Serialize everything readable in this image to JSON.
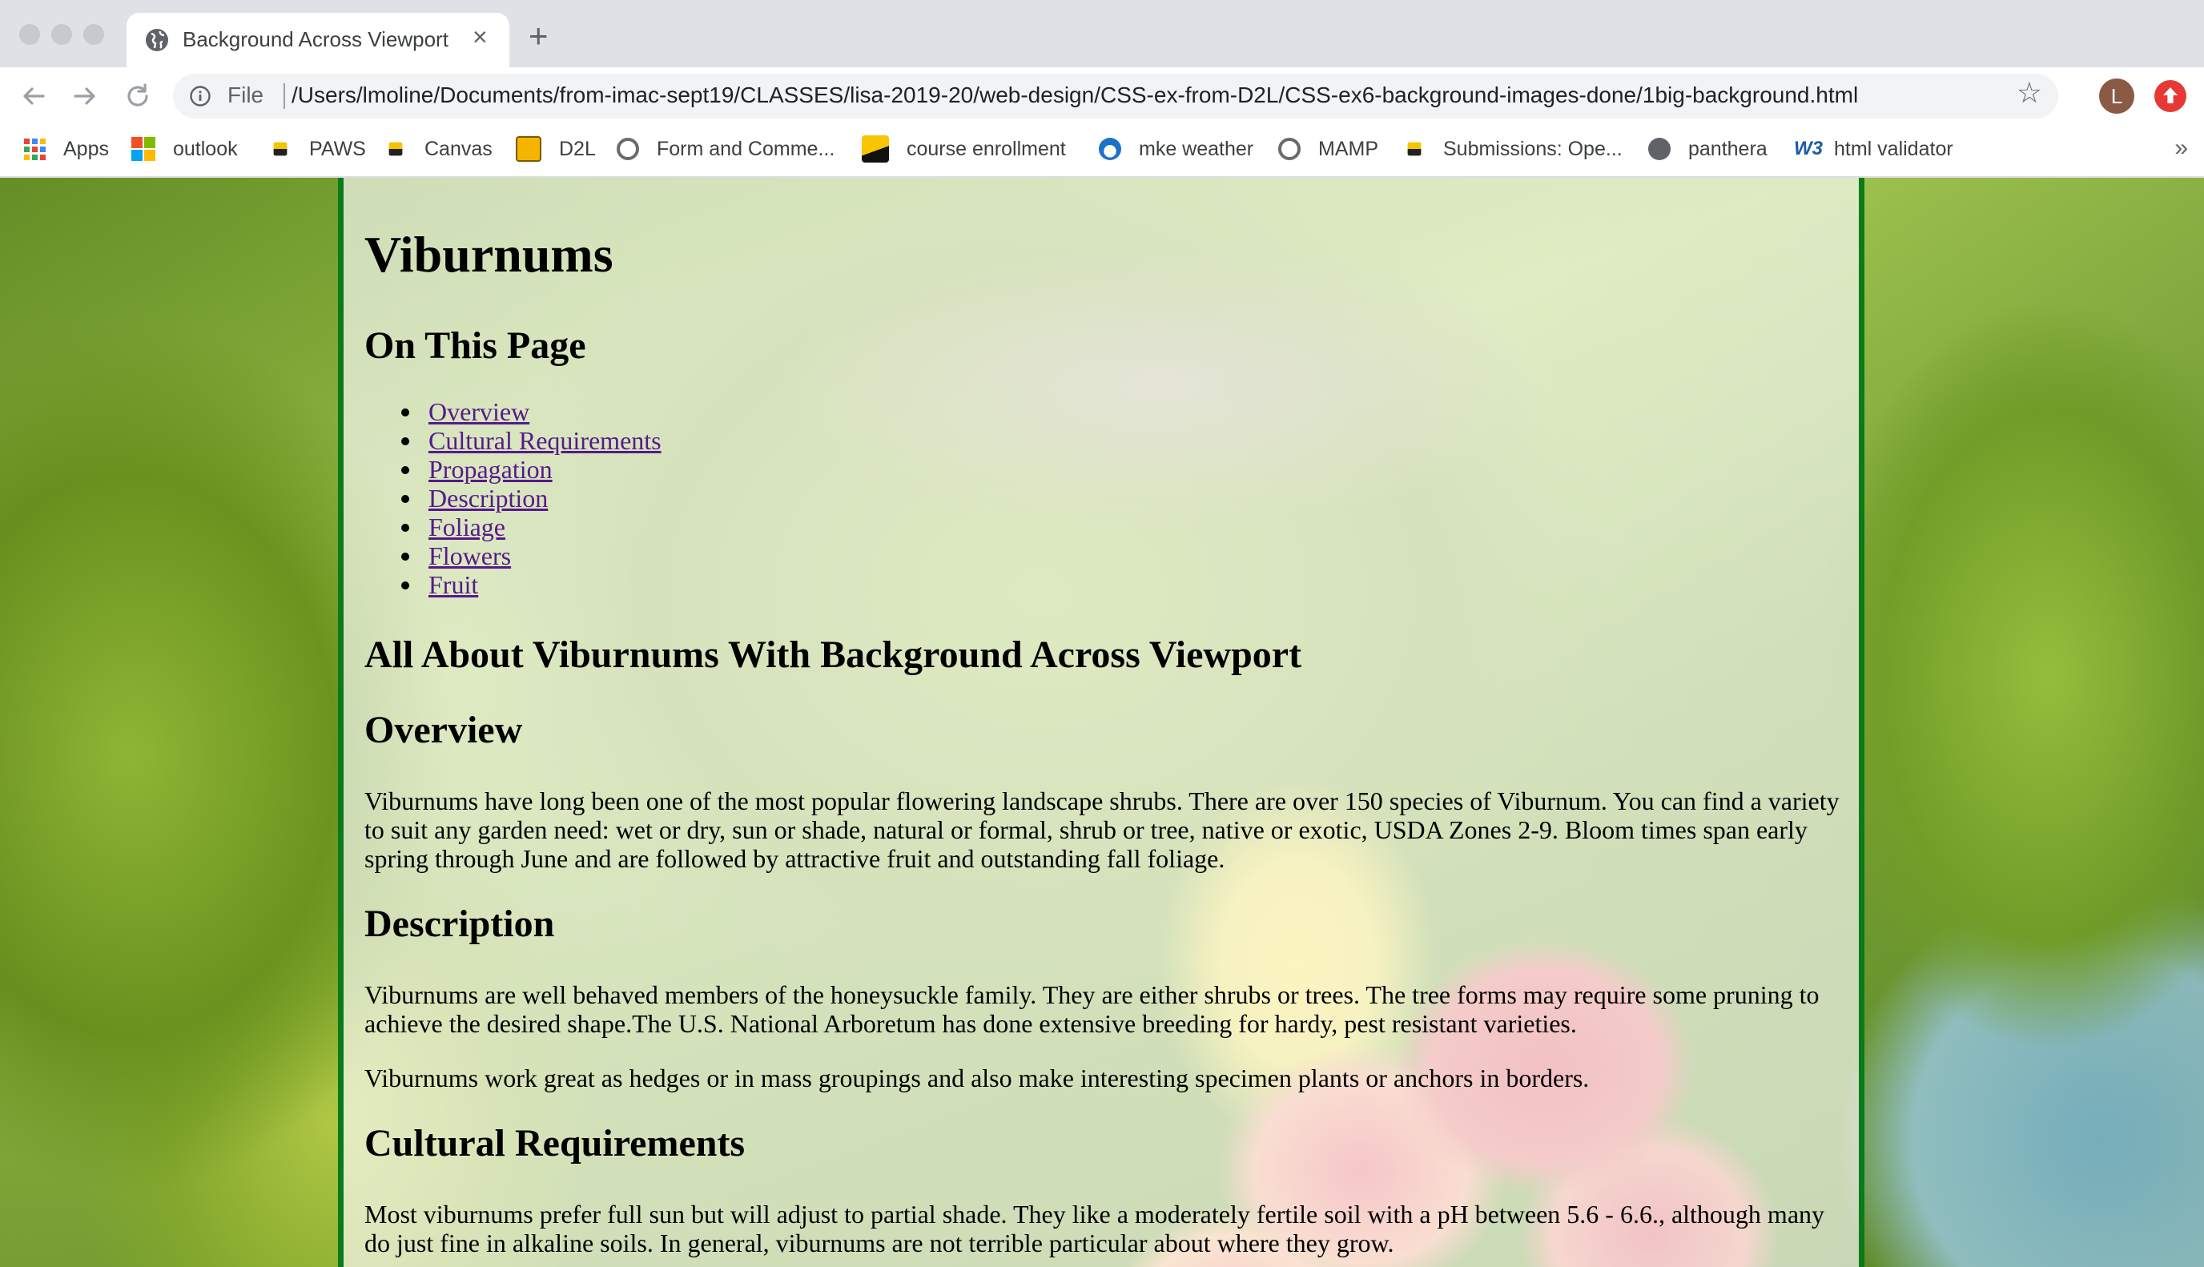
{
  "browser": {
    "tab_title": "Background Across Viewport",
    "new_tab_label": "+",
    "close_label": "×",
    "file_label": "File",
    "url": "/Users/lmoline/Documents/from-imac-sept19/CLASSES/lisa-2019-20/web-design/CSS-ex-from-D2L/CSS-ex6-background-images-done/1big-background.html",
    "profile_initial": "L",
    "bookmarks": [
      {
        "label": "Apps",
        "icon": "apps-grid-icon"
      },
      {
        "label": "outlook",
        "icon": "microsoft-icon"
      },
      {
        "label": "PAWS",
        "icon": "uwm-icon"
      },
      {
        "label": "Canvas",
        "icon": "uwm-icon"
      },
      {
        "label": "D2L",
        "icon": "d2l-icon"
      },
      {
        "label": "Form and Comme...",
        "icon": "globe-icon"
      },
      {
        "label": "course enrollment",
        "icon": "folder-icon"
      },
      {
        "label": "mke weather",
        "icon": "noaa-icon"
      },
      {
        "label": "MAMP",
        "icon": "globe-icon"
      },
      {
        "label": "Submissions: Ope...",
        "icon": "uwm-icon"
      },
      {
        "label": "panthera",
        "icon": "globe-icon"
      },
      {
        "label": "html validator",
        "icon": "w3c-icon"
      }
    ],
    "more_label": "»"
  },
  "page": {
    "title": "Viburnums",
    "toc_heading": "On This Page",
    "toc": [
      "Overview",
      "Cultural Requirements",
      "Propagation",
      "Description",
      "Foliage",
      "Flowers",
      "Fruit"
    ],
    "main_heading": "All About Viburnums With Background Across Viewport",
    "overview_heading": "Overview",
    "overview_text": "Viburnums have long been one of the most popular flowering landscape shrubs. There are over 150 species of Viburnum. You can find a variety to suit any garden need: wet or dry, sun or shade, natural or formal, shrub or tree, native or exotic, USDA Zones 2-9. Bloom times span early spring through June and are followed by attractive fruit and outstanding fall foliage.",
    "description_heading": "Description",
    "description_text_1": "Viburnums are well behaved members of the honeysuckle family. They are either shrubs or trees. The tree forms may require some pruning to achieve the desired shape.The U.S. National Arboretum has done extensive breeding for hardy, pest resistant varieties.",
    "description_text_2": "Viburnums work great as hedges or in mass groupings and also make interesting specimen plants or anchors in borders.",
    "cultural_heading": "Cultural Requirements",
    "cultural_text": "Most viburnums prefer full sun but will adjust to partial shade. They like a moderately fertile soil with a pH between 5.6 - 6.6., although many do just fine in alkaline soils. In general, viburnums are not terrible particular about where they grow."
  },
  "colors": {
    "border_green": "#0a7a1a",
    "link_visited": "#551a8b",
    "chrome_bg": "#dee1e6"
  }
}
